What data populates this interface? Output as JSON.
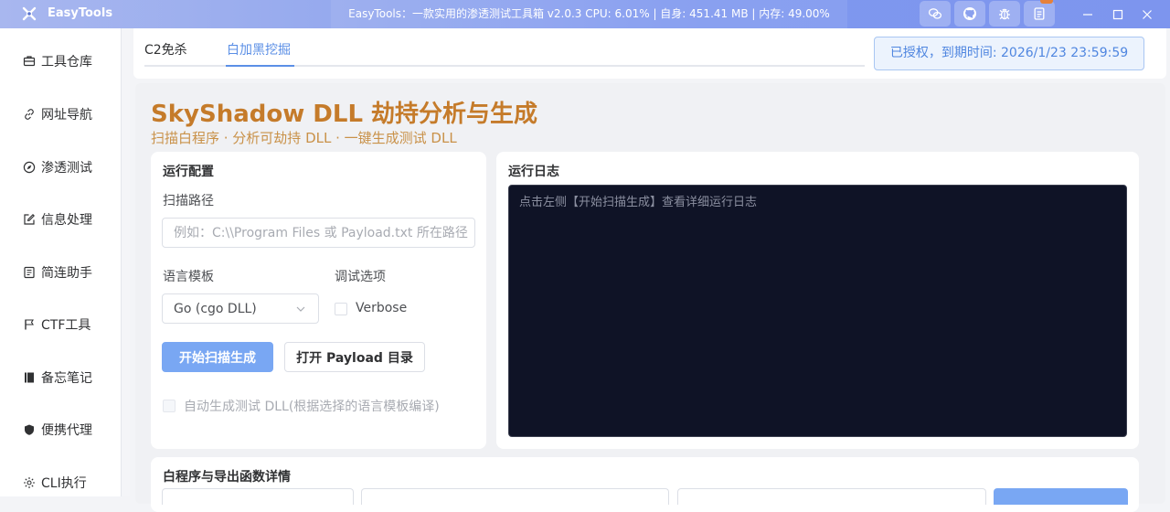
{
  "app": {
    "name": "EasyTools",
    "status": "EasyTools：一款实用的渗透测试工具箱 v2.0.3 CPU: 6.01% | 自身: 451.41 MB | 内存: 49.00%"
  },
  "titlebar_buttons": [
    {
      "icon": "wechat-icon"
    },
    {
      "icon": "github-icon"
    },
    {
      "icon": "bug-icon"
    },
    {
      "icon": "document-icon"
    }
  ],
  "sidebar": {
    "items": [
      {
        "label": "工具仓库",
        "icon": "briefcase-icon"
      },
      {
        "label": "网址导航",
        "icon": "link-icon"
      },
      {
        "label": "渗透测试",
        "icon": "compass-icon"
      },
      {
        "label": "信息处理",
        "icon": "edit-icon"
      },
      {
        "label": "简连助手",
        "icon": "notebook-icon"
      },
      {
        "label": "CTF工具",
        "icon": "flag-icon"
      },
      {
        "label": "备忘笔记",
        "icon": "memo-icon"
      },
      {
        "label": "便携代理",
        "icon": "shield-icon"
      },
      {
        "label": "CLI执行",
        "icon": "sun-icon"
      }
    ]
  },
  "tabs": [
    {
      "label": "C2免杀",
      "active": false
    },
    {
      "label": "白加黑挖掘",
      "active": true
    }
  ],
  "license": "已授权，到期时间: 2026/1/23 23:59:59",
  "main": {
    "title": "SkyShadow DLL 劫持分析与生成",
    "subtitle": "扫描白程序 · 分析可劫持 DLL · 一键生成测试 DLL"
  },
  "config": {
    "title": "运行配置",
    "scan_path_label": "扫描路径",
    "scan_path_placeholder": "例如：C:\\\\Program Files 或 Payload.txt 所在路径",
    "lang_label": "语言模板",
    "lang_value": "Go (cgo DLL)",
    "debug_label": "调试选项",
    "verbose_label": "Verbose",
    "start_button": "开始扫描生成",
    "open_button": "打开 Payload 目录",
    "auto_gen_label": "自动生成测试 DLL(根据选择的语言模板编译)"
  },
  "log": {
    "title": "运行日志",
    "placeholder": "点击左侧【开始扫描生成】查看详细运行日志"
  },
  "details": {
    "title": "白程序与导出函数详情"
  },
  "colors": {
    "accent": "#5b8fe6",
    "title_orange": "#c57b2a",
    "primary_button": "#79a7f3",
    "console_bg": "#0f1326"
  }
}
